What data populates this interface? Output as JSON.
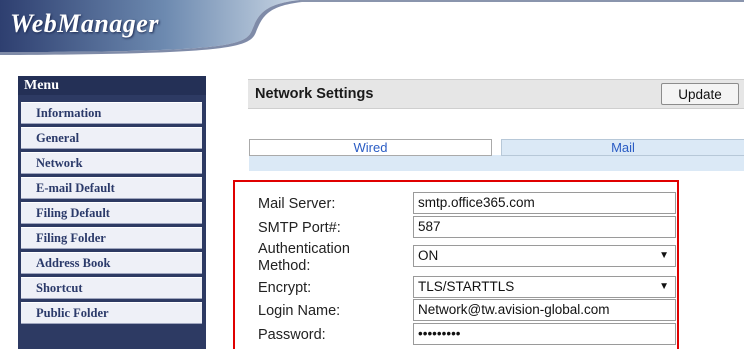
{
  "app": {
    "title": "WebManager"
  },
  "sidebar": {
    "heading": "Menu",
    "items": [
      {
        "label": "Information"
      },
      {
        "label": "General"
      },
      {
        "label": "Network"
      },
      {
        "label": "E-mail Default"
      },
      {
        "label": "Filing Default"
      },
      {
        "label": "Filing Folder"
      },
      {
        "label": "Address Book"
      },
      {
        "label": "Shortcut"
      },
      {
        "label": "Public Folder"
      }
    ]
  },
  "page": {
    "title": "Network Settings",
    "update_label": "Update"
  },
  "tabs": [
    {
      "label": "Wired",
      "selected": false
    },
    {
      "label": "Mail",
      "selected": true
    }
  ],
  "form": {
    "mail_server": {
      "label": "Mail Server:",
      "value": "smtp.office365.com"
    },
    "smtp_port": {
      "label": "SMTP Port#:",
      "value": "587"
    },
    "auth_method": {
      "label_line1": "Authentication",
      "label_line2": "Method:",
      "value": "ON"
    },
    "encrypt": {
      "label": "Encrypt:",
      "value": "TLS/STARTTLS"
    },
    "login_name": {
      "label": "Login Name:",
      "value": "Network@tw.avision-global.com"
    },
    "password": {
      "label": "Password:",
      "value": "•••••••••"
    }
  },
  "colors": {
    "sidebar_bg": "#2d3a63",
    "menu_item_bg": "#eef0f7",
    "menu_text": "#2b3a6a",
    "tab_selected_bg": "#dbe9f6",
    "tab_text": "#2a5cc4",
    "highlight_border": "#e00000"
  },
  "icons": {
    "select_arrow": "dropdown-arrow-icon"
  }
}
